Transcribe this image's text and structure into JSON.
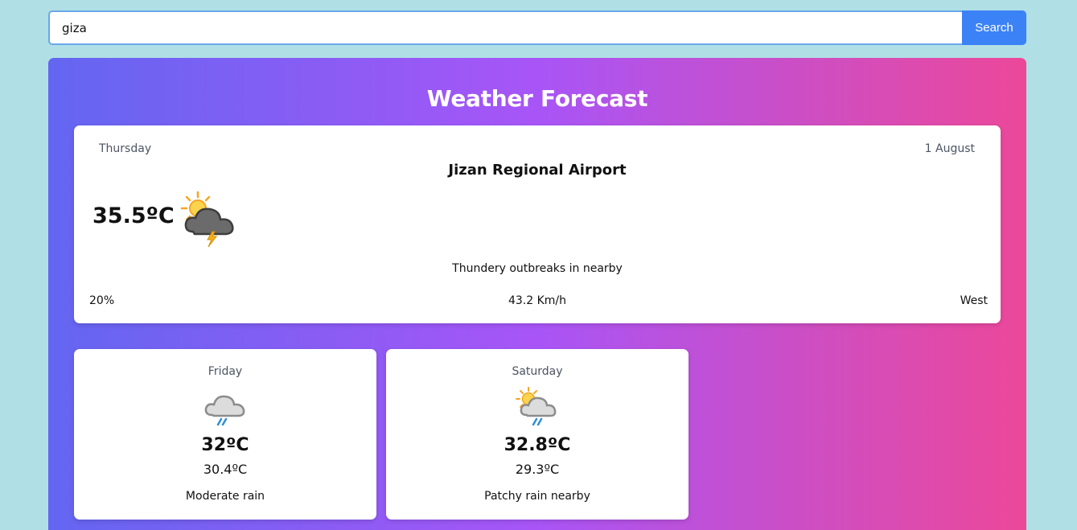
{
  "search": {
    "value": "giza",
    "button_label": "Search"
  },
  "panel": {
    "title": "Weather Forecast"
  },
  "today": {
    "day": "Thursday",
    "date": "1 August",
    "location": "Jizan Regional Airport",
    "temperature": "35.5ºC",
    "icon": "sun-cloud-thunder-icon",
    "condition": "Thundery outbreaks in nearby",
    "humidity": "20%",
    "wind_speed": "43.2 Km/h",
    "wind_direction": "West"
  },
  "forecast": [
    {
      "day": "Friday",
      "icon": "cloud-rain-icon",
      "max_temp": "32ºC",
      "min_temp": "30.4ºC",
      "condition": "Moderate rain"
    },
    {
      "day": "Saturday",
      "icon": "sun-cloud-rain-icon",
      "max_temp": "32.8ºC",
      "min_temp": "29.3ºC",
      "condition": "Patchy rain nearby"
    }
  ],
  "colors": {
    "background": "#b0dfe5",
    "gradient_start": "#6366f1",
    "gradient_mid": "#a855f7",
    "gradient_end": "#ec4899",
    "search_button": "#3b82f6"
  }
}
